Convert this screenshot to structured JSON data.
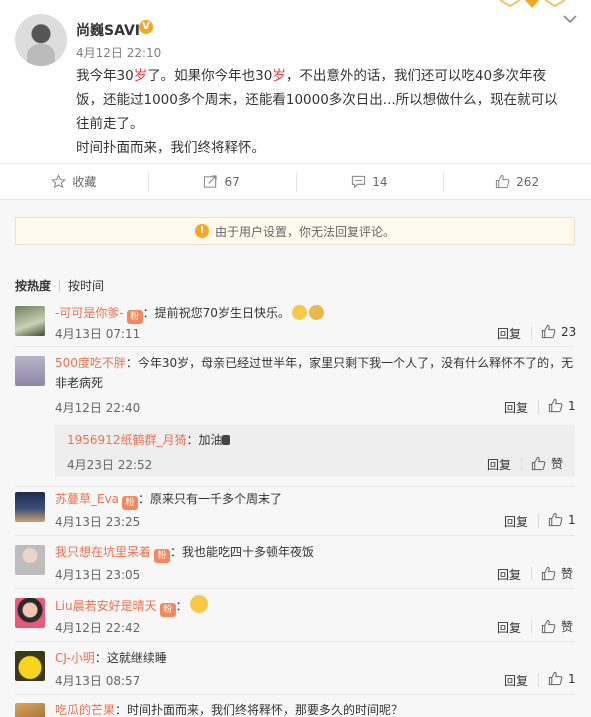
{
  "post": {
    "username": "尚巍SAVI",
    "time": "4月12日 22:10",
    "text_line1_a": "我今年30",
    "text_line1_b": "岁",
    "text_line1_c": "了。如果你今年也30",
    "text_line1_d": "岁",
    "text_line1_e": "，不出意外的话，我们还可以吃40多次年夜",
    "text_line2": "饭，还能过1000多个周末，还能看10000多次日出...所以想做什么，现在就可以",
    "text_line3": "往前走了。",
    "text_line4": "时间扑面而来，我们终将释怀。"
  },
  "actions": {
    "favorite": "收藏",
    "repost": "67",
    "comment": "14",
    "like": "262"
  },
  "notice": "由于用户设置，你无法回复评论。",
  "sort": {
    "hot": "按热度",
    "time": "按时间"
  },
  "reply_label": "回复",
  "comments": [
    {
      "user": "-可可是你爹-",
      "text": "：提前祝您70岁生日快乐。",
      "time": "4月13日 07:11",
      "likes": "23"
    },
    {
      "user": "500度吃不胖",
      "text": "：今年30岁，母亲已经过世半年，家里只剩下我一个人了，没有什么释怀不了的，无",
      "text2": "非老病死",
      "time": "4月12日 22:40",
      "likes": "1"
    },
    {
      "user": "苏蔓草_Eva",
      "text": "：原来只有一千多个周末了",
      "time": "4月13日 23:25",
      "likes": "1"
    },
    {
      "user": "我只想在坑里呆着",
      "text": "：我也能吃四十多顿年夜饭",
      "time": "4月13日 23:05",
      "likes": "赞"
    },
    {
      "user": "Liu晨若安好是晴天",
      "text": "：",
      "time": "4月12日 22:42",
      "likes": "赞"
    },
    {
      "user": "CJ-小明",
      "text": "：这就继续睡",
      "time": "4月13日 08:57",
      "likes": "1"
    },
    {
      "user": "吃瓜的芒果",
      "text": "：时间扑面而来，我们终将释怀，那要多久的时间呢？"
    }
  ],
  "subreply": {
    "user": "1956912纸鹤群_月猗",
    "text": "：加油",
    "time": "4月23日 22:52",
    "likes": "赞"
  }
}
